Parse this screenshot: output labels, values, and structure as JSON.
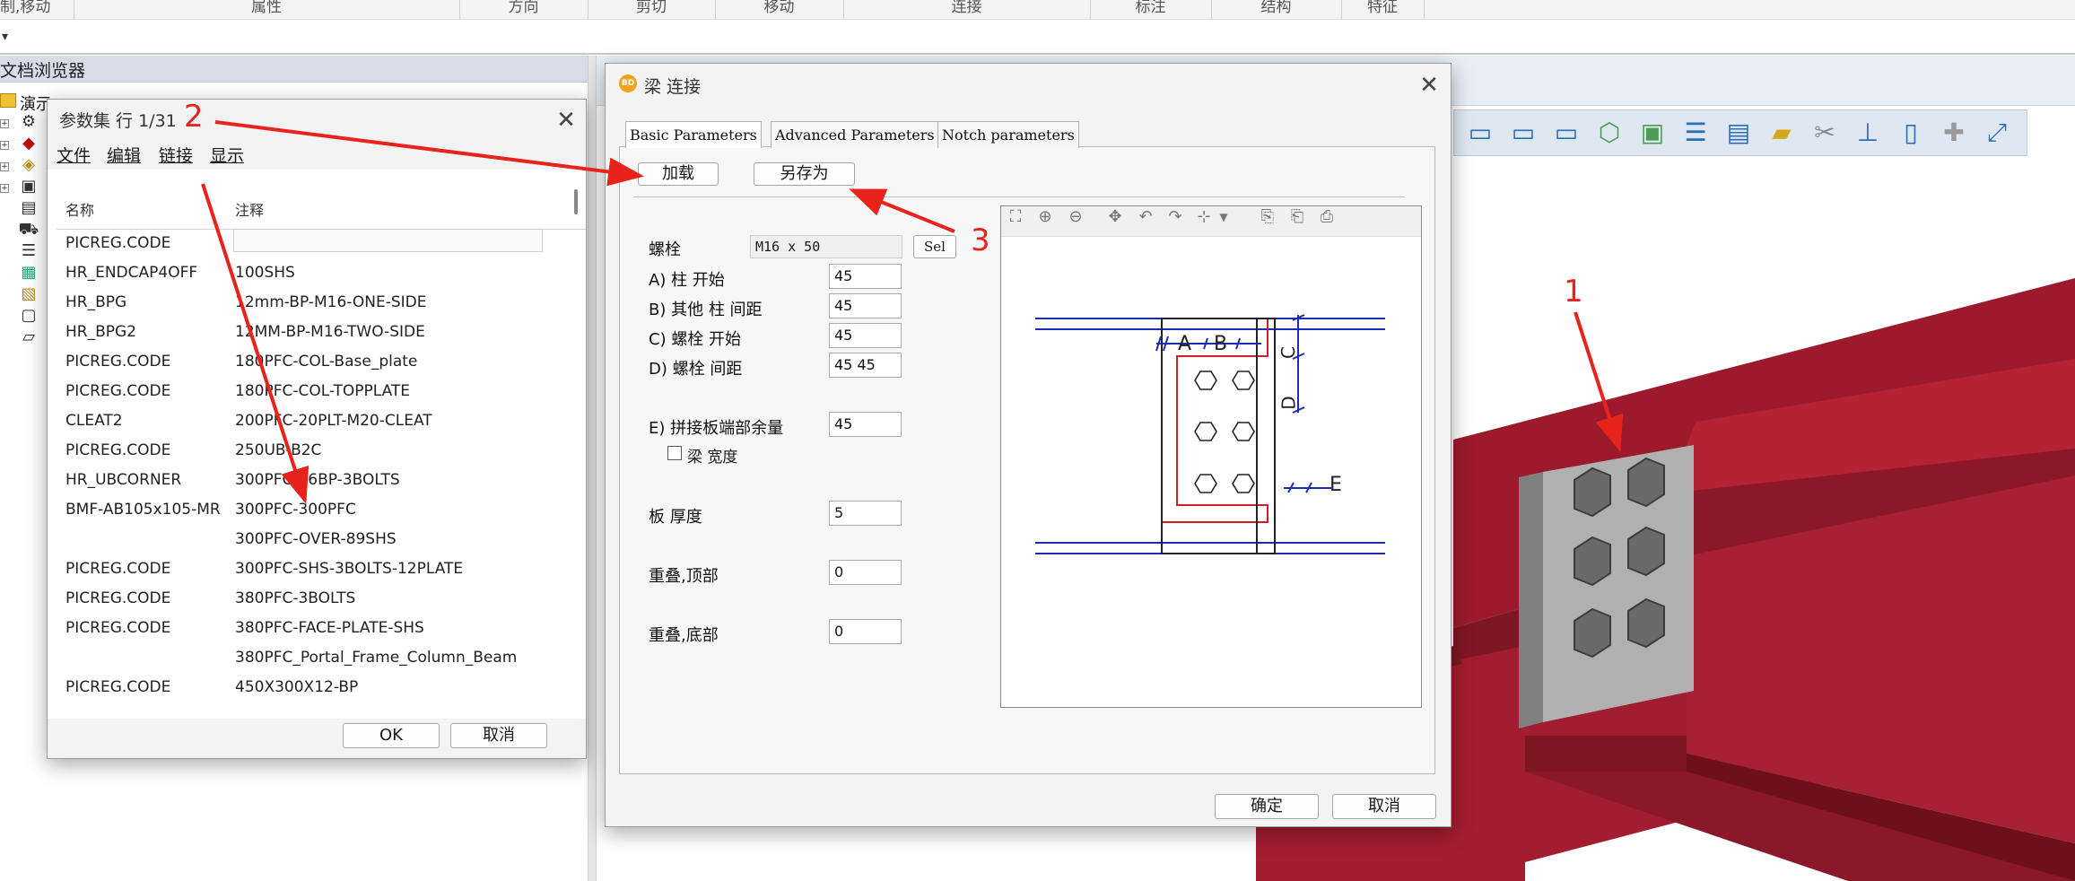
{
  "ribbon": {
    "groups": [
      "制,移动",
      "属性",
      "方向",
      "剪切",
      "移动",
      "连接",
      "标注",
      "结构",
      "特征"
    ]
  },
  "quick_access": {
    "caret": "▾"
  },
  "doc_browser": {
    "title": "文档浏览器",
    "root_label": "演示"
  },
  "param_dialog": {
    "title": "参数集 行 1/31",
    "menus": [
      "文件",
      "编辑",
      "链接",
      "显示"
    ],
    "columns": {
      "name": "名称",
      "note": "注释"
    },
    "rows": [
      {
        "name": "PICREG.CODE",
        "note": ""
      },
      {
        "name": "HR_ENDCAP4OFF",
        "note": "100SHS"
      },
      {
        "name": "HR_BPG",
        "note": "12mm-BP-M16-ONE-SIDE"
      },
      {
        "name": "HR_BPG2",
        "note": "12MM-BP-M16-TWO-SIDE"
      },
      {
        "name": "PICREG.CODE",
        "note": "180PFC-COL-Base_plate"
      },
      {
        "name": "PICREG.CODE",
        "note": "180PFC-COL-TOPPLATE"
      },
      {
        "name": "CLEAT2",
        "note": "200PFC-20PLT-M20-CLEAT"
      },
      {
        "name": "PICREG.CODE",
        "note": "250UB-B2C"
      },
      {
        "name": "HR_UBCORNER",
        "note": "300PFC-16BP-3BOLTS"
      },
      {
        "name": "BMF-AB105x105-MR",
        "note": "300PFC-300PFC"
      },
      {
        "name": "",
        "note": "300PFC-OVER-89SHS"
      },
      {
        "name": "PICREG.CODE",
        "note": "300PFC-SHS-3BOLTS-12PLATE"
      },
      {
        "name": "PICREG.CODE",
        "note": "380PFC-3BOLTS"
      },
      {
        "name": "PICREG.CODE",
        "note": "380PFC-FACE-PLATE-SHS"
      },
      {
        "name": "",
        "note": "380PFC_Portal_Frame_Column_Beam"
      },
      {
        "name": "PICREG.CODE",
        "note": "450X300X12-BP"
      }
    ],
    "ok_label": "OK",
    "cancel_label": "取消"
  },
  "beam_dialog": {
    "title": "梁 连接",
    "logo_text": "BD",
    "tabs": [
      "Basic Parameters",
      "Advanced Parameters",
      "Notch parameters"
    ],
    "load_label": "加载",
    "save_as_label": "另存为",
    "bolt_label": "螺栓",
    "bolt_value": "M16 x 50",
    "sel_label": "Sel",
    "fields": [
      {
        "label": "A) 柱 开始",
        "value": "45"
      },
      {
        "label": "B) 其他 柱 间距",
        "value": "45"
      },
      {
        "label": "C) 螺栓 开始",
        "value": "45"
      },
      {
        "label": "D) 螺栓 间距",
        "value": "45 45"
      },
      {
        "label": "E) 拼接板端部余量",
        "value": "45"
      }
    ],
    "beam_width_label": "梁 宽度",
    "plate_thickness": {
      "label": "板 厚度",
      "value": "5"
    },
    "overlap_top": {
      "label": "重叠,顶部",
      "value": "0"
    },
    "overlap_bottom": {
      "label": "重叠,底部",
      "value": "0"
    },
    "preview_labels": {
      "a": "A",
      "b": "B",
      "c": "C",
      "d": "D",
      "e": "E"
    },
    "confirm_label": "确定",
    "cancel_label": "取消"
  },
  "annotations": [
    "1",
    "2",
    "3"
  ],
  "colors": {
    "beam_red": "#9c1a2c",
    "beam_red_dark": "#6e0f1c",
    "annotation_red": "#e8231c",
    "preview_blue": "#1a2fb0",
    "preview_red": "#cc1f2a"
  }
}
